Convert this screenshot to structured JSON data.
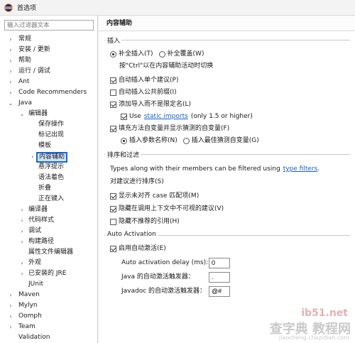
{
  "window": {
    "title": "首选项"
  },
  "filter": {
    "placeholder": "输入过滤器文本"
  },
  "tree": [
    {
      "label": "常规",
      "arrow": "›"
    },
    {
      "label": "安装 / 更新",
      "arrow": "›"
    },
    {
      "label": "帮助",
      "arrow": "›"
    },
    {
      "label": "运行 / 调试",
      "arrow": "›"
    },
    {
      "label": "Ant",
      "arrow": "›"
    },
    {
      "label": "Code Recommenders",
      "arrow": "›"
    },
    {
      "label": "Java",
      "arrow": "⌄"
    },
    {
      "label": "编辑器",
      "arrow": "⌄"
    },
    {
      "label": "保存操作",
      "arrow": ""
    },
    {
      "label": "标记出现",
      "arrow": ""
    },
    {
      "label": "模板",
      "arrow": ""
    },
    {
      "label": "内容辅助",
      "arrow": "›"
    },
    {
      "label": "悬浮提示",
      "arrow": ""
    },
    {
      "label": "语法着色",
      "arrow": ""
    },
    {
      "label": "折叠",
      "arrow": ""
    },
    {
      "label": "正在键入",
      "arrow": ""
    },
    {
      "label": "编译器",
      "arrow": "›"
    },
    {
      "label": "代码样式",
      "arrow": "›"
    },
    {
      "label": "调试",
      "arrow": "›"
    },
    {
      "label": "构建路径",
      "arrow": "›"
    },
    {
      "label": "属性文件编辑器",
      "arrow": ""
    },
    {
      "label": "外观",
      "arrow": "›"
    },
    {
      "label": "已安装的 JRE",
      "arrow": "›"
    },
    {
      "label": "JUnit",
      "arrow": ""
    },
    {
      "label": "Maven",
      "arrow": "›"
    },
    {
      "label": "Mylyn",
      "arrow": "›"
    },
    {
      "label": "Oomph",
      "arrow": "›"
    },
    {
      "label": "Team",
      "arrow": "›"
    },
    {
      "label": "Validation",
      "arrow": ""
    }
  ],
  "panel": {
    "title": "内容辅助",
    "insertion": {
      "group_title": "插入",
      "radio_insert": "补全插入(T)",
      "radio_overwrite": "补全覆盖(W)",
      "hint": "按\"Ctrl\"以在内容辅助活动时切换",
      "auto_insert_single": "自动插入单个建议(P)",
      "auto_insert_prefix": "自动插入公共前缀(I)",
      "add_import": "添加导入而不是限定名(L)",
      "use_prefix": "Use",
      "use_link": "static imports",
      "use_suffix": "(only 1.5 or higher)",
      "fill_args": "填充方法自变量并显示猜测的自变量(F)",
      "radio_param_names": "插入参数名称(N)",
      "radio_best_guess": "插入最佳猜测自变量(G)"
    },
    "sorting": {
      "group_title": "排序和过滤",
      "desc_prefix": "Types along with their members can be filtered using",
      "desc_link": "type filters",
      "desc_suffix": ".",
      "sort_label": "对建议进行排序(S)",
      "show_camel": "显示未对齐 case 匹配项(M)",
      "hide_inaccessible": "隐藏在调用上下文中不可视的建议(V)",
      "hide_deprecated": "隐藏不推荐的引用(H)"
    },
    "auto_activation": {
      "group_title": "Auto Activation",
      "enable": "启用自动激活(E)",
      "delay_label": "Auto activation delay (ms):",
      "delay_value": "0",
      "java_triggers_label": "Java 的自动激活触发器：",
      "java_triggers_value": ".",
      "javadoc_triggers_label": "Javadoc 的自动激活触发器：",
      "javadoc_triggers_value": "@#"
    }
  },
  "watermark": {
    "line1": "ib51.net",
    "line2": "查字典 教程网",
    "line3": "jiaocheng.chazidian.com"
  }
}
